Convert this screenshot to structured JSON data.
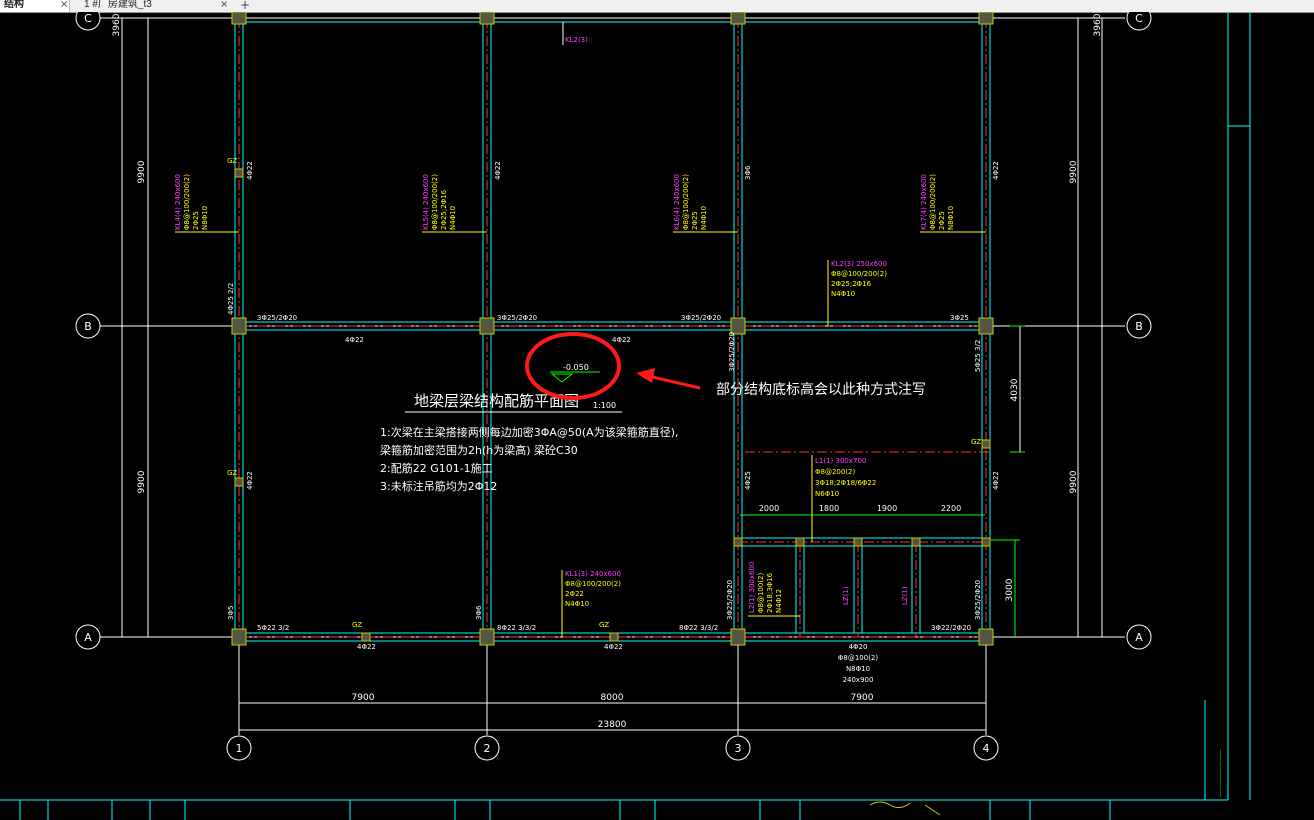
{
  "tabs": [
    {
      "label": "结构",
      "active": true
    },
    {
      "label": "1 #厂房建筑_t3",
      "active": false
    }
  ],
  "axes": {
    "rows": [
      "C",
      "B",
      "A"
    ],
    "cols": [
      "1",
      "2",
      "3",
      "4"
    ],
    "left_dims": [
      "3960",
      "9900",
      "9900"
    ],
    "right_dims": [
      "3960",
      "9900",
      "9900"
    ],
    "bottom_spans": [
      "7900",
      "8000",
      "7900"
    ],
    "bottom_total": "23800",
    "right_sub_dims": [
      "4030",
      "3000"
    ]
  },
  "drawing": {
    "title": "地梁层梁结构配筋平面图",
    "scale": "1:100",
    "notes": [
      "1:次梁在主梁搭接两侧每边加密3ΦA@50(A为该梁箍筋直径),",
      "   梁箍筋加密范围为2h(h为梁高)   梁砼C30",
      "2:配筋22 G101-1施工",
      "3:未标注吊筋均为2Φ12"
    ],
    "elevation": "-0.050",
    "annotation": "部分结构底标高会以此种方式注写"
  },
  "beams": {
    "kl2": "KL2(3)",
    "kl4_1": "KL4(4) 240x600",
    "kl4_2": "Φ8@100/200(2)",
    "kl4_3": "2Φ25",
    "kl4_4": "N8Φ10",
    "kl5_1": "KL5(4) 240x600",
    "kl5_2": "Φ8@100/200(2)",
    "kl5_3": "2Φ25;2Φ16",
    "kl5_4": "N4Φ10",
    "kl6_1": "KL6(4) 240x600",
    "kl6_2": "Φ8@100/200(2)",
    "kl6_3": "2Φ25",
    "kl6_4": "N4Φ10",
    "kl7_1": "KL7(4) 240x600",
    "kl7_2": "Φ8@100/200(2)",
    "kl7_3": "2Φ25",
    "kl7_4": "N8Φ10",
    "klb_1": "KL2(3) 250x600",
    "klb_2": "Φ8@100/200(2)",
    "klb_3": "2Φ25;2Φ16",
    "klb_4": "N4Φ10",
    "kla_1": "KL1(3) 240x600",
    "kla_2": "Φ8@100/200(2)",
    "kla_3": "2Φ22",
    "kla_4": "N4Φ10",
    "l1_1": "L1(1) 300x700",
    "l1_2": "Φ8@200(2)",
    "l1_3": "3Φ18;2Φ18/6Φ22",
    "l1_4": "N6Φ10",
    "l2_1": "L2(1) 300x600",
    "l2_2": "Φ8@100(2)",
    "l2_3": "2Φ18;3Φ16",
    "l2_4": "N4Φ12",
    "lz1": "LZ(1)",
    "lz2": "LZ(1)",
    "bot_1": "Φ8@100(2)",
    "bot_2": "N8Φ10",
    "bot_3": "240x900"
  },
  "rebar": {
    "gz": "GZ",
    "r4d22": "4Φ22",
    "r3d6": "3Φ6",
    "r3d25_2d20": "3Φ25/2Φ20",
    "r3d25_2": "3Φ25/2Φ20",
    "r3d25_3": "3Φ25/2Φ20",
    "r3d25": "3Φ25",
    "r4d25": "4Φ25 2/2",
    "r5d25": "5Φ25 3/2",
    "r5d22": "5Φ22 3/2",
    "r8d22": "8Φ22 3/3/2",
    "r8d22b": "8Φ22 3/3/2",
    "r3d22": "3Φ22/2Φ20",
    "r3d25v": "3Φ25/2Φ20",
    "r3d25v2": "3Φ25/2Φ20",
    "r3d5": "3Φ5",
    "r3d6b": "3Φ6",
    "r4d20": "4Φ20",
    "r2d22": "4Φ22",
    "r4d25v": "4Φ25",
    "r3d25a": "3Φ25/2Φ20"
  },
  "sub_dims": [
    "2000",
    "1800",
    "1900",
    "2200"
  ],
  "colors": {
    "axis": "#ffffff",
    "beam": "#00ffff",
    "red": "#ff3030",
    "yellow": "#ffff00",
    "magenta": "#ff40ff",
    "green": "#00ff00",
    "highlight": "#ff1a1a"
  }
}
